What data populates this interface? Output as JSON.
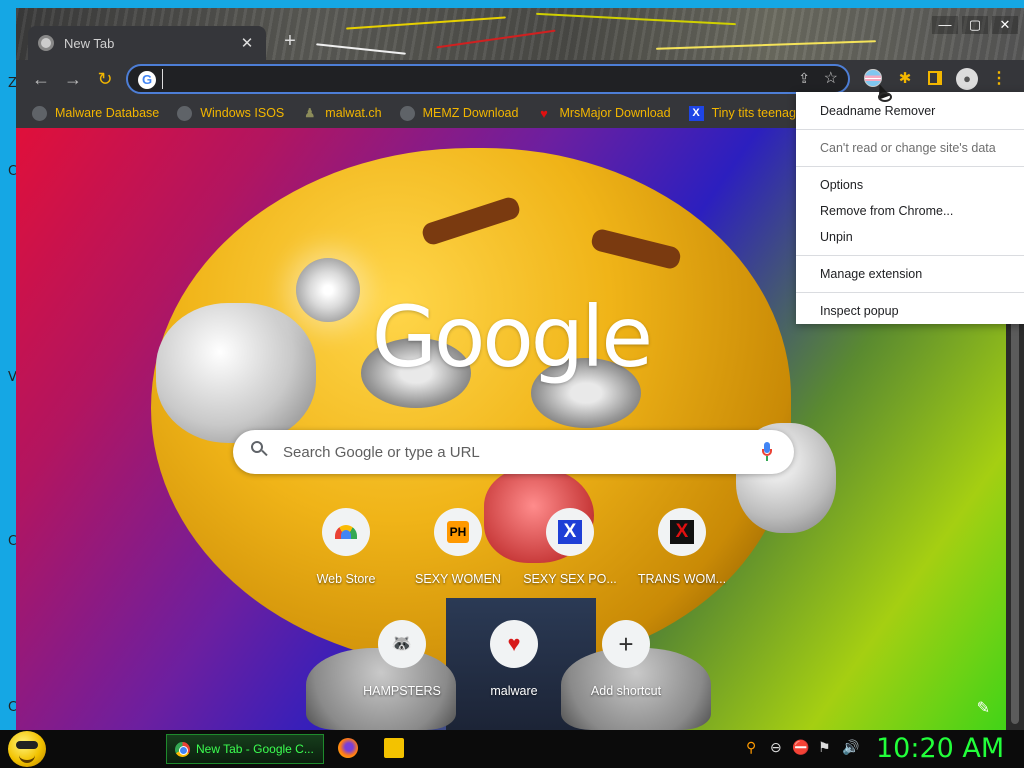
{
  "desktop": {
    "letters": [
      "Z",
      "C",
      "V",
      "C",
      "C"
    ]
  },
  "browser": {
    "tab_title": "New Tab",
    "tab_close": "✕",
    "new_tab": "+",
    "window_controls": {
      "minimize": "—",
      "maximize": "▢",
      "close": "✕"
    },
    "nav": {
      "back": "←",
      "forward": "→",
      "reload": "↻"
    },
    "omnibox": {
      "value": "",
      "google_glyph": "G",
      "share": "⇪",
      "star": "☆"
    },
    "toolbar": {
      "puzzle": "✱",
      "profile": "●",
      "menu": "⋮"
    },
    "bookmarks": [
      {
        "label": "Malware Database",
        "icon": "globe-icon"
      },
      {
        "label": "Windows ISOS",
        "icon": "globe-icon"
      },
      {
        "label": "malwat.ch",
        "icon": "mole-icon"
      },
      {
        "label": "MEMZ Download",
        "icon": "globe-icon"
      },
      {
        "label": "MrsMajor Download",
        "icon": "heart-icon"
      },
      {
        "label": "Tiny tits teenager bl...",
        "icon": "x-icon"
      }
    ]
  },
  "ntp": {
    "logo": "Google",
    "search_placeholder": "Search Google or type a URL",
    "shortcuts": [
      {
        "label": "Web Store",
        "icon": "webstore-icon"
      },
      {
        "label": "SEXY WOMEN",
        "icon": "ph-icon",
        "glyph": "PH"
      },
      {
        "label": "SEXY SEX PO...",
        "icon": "x-blue-icon",
        "glyph": "X"
      },
      {
        "label": "TRANS WOM...",
        "icon": "x-red-icon",
        "glyph": "X"
      },
      {
        "label": "HAMPSTERS",
        "icon": "raccoon-icon",
        "glyph": "🦝"
      },
      {
        "label": "malware",
        "icon": "heart-icon",
        "glyph": "♥"
      },
      {
        "label": "Add shortcut",
        "icon": "plus-icon",
        "glyph": "+"
      }
    ],
    "customize_glyph": "✎"
  },
  "context_menu": {
    "extension_name": "Deadname Remover",
    "site_access": "Can't read or change site's data",
    "options": "Options",
    "remove": "Remove from Chrome...",
    "unpin": "Unpin",
    "manage": "Manage extension",
    "inspect": "Inspect popup"
  },
  "taskbar": {
    "active_window": "New Tab - Google C...",
    "tray_icons": [
      "search-icon",
      "remove-icon",
      "network-blocked-icon",
      "security-flag-icon",
      "network-icon",
      "volume-icon"
    ],
    "tray_glyphs": [
      "⚲",
      "⊖",
      "⛔",
      "⚑",
      "⊞",
      "🔊"
    ],
    "clock": "10:20 AM"
  },
  "colors": {
    "accent_yellow": "#f2b600",
    "clock_green": "#22ff3a",
    "omnibox_focus": "#4d7ed6"
  }
}
